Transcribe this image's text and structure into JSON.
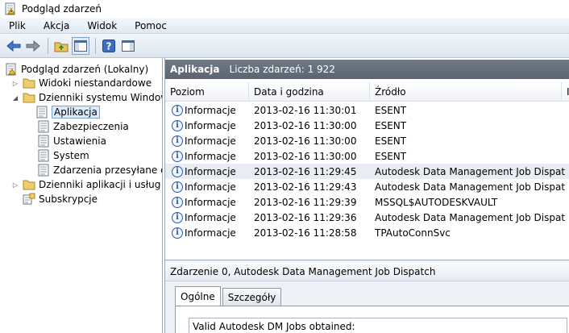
{
  "window": {
    "title": "Podgląd zdarzeń"
  },
  "menu": [
    "Plik",
    "Akcja",
    "Widok",
    "Pomoc"
  ],
  "tree": {
    "root": "Podgląd zdarzeń (Lokalny)",
    "custom_views": "Widoki niestandardowe",
    "windows_logs": "Dzienniki systemu Windows",
    "logs": [
      "Aplikacja",
      "Zabezpieczenia",
      "Ustawienia",
      "System",
      "Zdarzenia przesyłane dale"
    ],
    "app_logs": "Dzienniki aplikacji i usług",
    "subscriptions": "Subskrypcje"
  },
  "pane": {
    "title": "Aplikacja",
    "count_label": "Liczba zdarzeń: 1 922"
  },
  "grid": {
    "columns": [
      "Poziom",
      "Data i godzina",
      "Źródło",
      "I"
    ],
    "rows": [
      [
        "Informacje",
        "2013-02-16 11:30:01",
        "ESENT"
      ],
      [
        "Informacje",
        "2013-02-16 11:30:00",
        "ESENT"
      ],
      [
        "Informacje",
        "2013-02-16 11:30:00",
        "ESENT"
      ],
      [
        "Informacje",
        "2013-02-16 11:30:00",
        "ESENT"
      ],
      [
        "Informacje",
        "2013-02-16 11:29:45",
        "Autodesk Data Management Job Dispatch"
      ],
      [
        "Informacje",
        "2013-02-16 11:29:43",
        "Autodesk Data Management Job Dispatch"
      ],
      [
        "Informacje",
        "2013-02-16 11:29:39",
        "MSSQL$AUTODESKVAULT"
      ],
      [
        "Informacje",
        "2013-02-16 11:29:36",
        "Autodesk Data Management Job Dispatch"
      ],
      [
        "Informacje",
        "2013-02-16 11:28:58",
        "TPAutoConnSvc"
      ]
    ]
  },
  "details": {
    "header": "Zdarzenie 0, Autodesk Data Management Job Dispatch",
    "tabs": [
      "Ogólne",
      "Szczegóły"
    ],
    "description": "Valid Autodesk DM Jobs obtained:"
  },
  "colors": {
    "header_bg": "#5b6571",
    "info_icon": "#2c5ba6",
    "selection": "#dcebfc"
  }
}
